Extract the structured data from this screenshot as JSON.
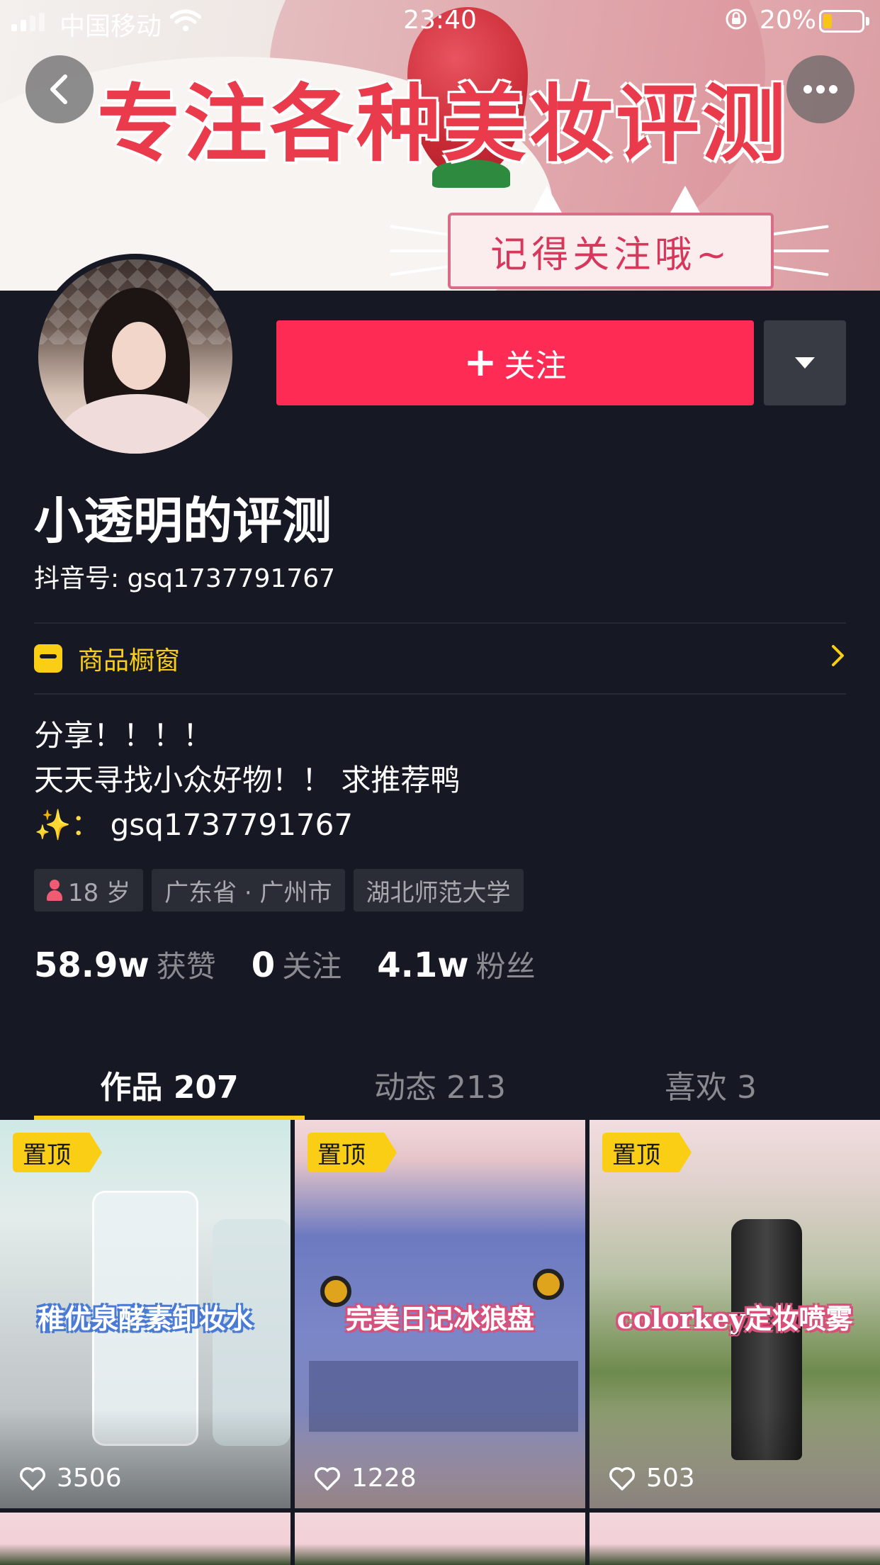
{
  "status_bar": {
    "carrier": "中国移动",
    "time": "23:40",
    "battery": "20%"
  },
  "banner": {
    "title": "专注各种美妆评测",
    "subtitle": "记得关注哦~"
  },
  "header": {
    "back_icon": "back-chevron-icon",
    "more_icon": "more-dots-icon"
  },
  "profile": {
    "follow_label": "关注",
    "follow_plus": "+",
    "name": "小透明的评测",
    "douyin_id": "抖音号: gsq1737791767"
  },
  "shop": {
    "label": "商品橱窗",
    "icon": "shop-icon"
  },
  "bio": {
    "line1": "分享！！！！",
    "line2": "天天寻找小众好物！！ 求推荐鸭",
    "line3_prefix": "✨：",
    "line3_value": "gsq1737791767"
  },
  "tags": {
    "age": "18 岁",
    "location": "广东省 · 广州市",
    "school": "湖北师范大学"
  },
  "stats": {
    "likes_num": "58.9w",
    "likes_label": "获赞",
    "following_num": "0",
    "following_label": "关注",
    "fans_num": "4.1w",
    "fans_label": "粉丝"
  },
  "tabs": [
    {
      "label": "作品 207"
    },
    {
      "label": "动态 213"
    },
    {
      "label": "喜欢 3"
    }
  ],
  "videos": [
    {
      "pin": "置顶",
      "cover_text": "稚优泉酵素卸妆水",
      "likes": "3506"
    },
    {
      "pin": "置顶",
      "cover_text": "完美日记冰狼盘",
      "likes": "1228"
    },
    {
      "pin": "置顶",
      "cover_text": "colorkey定妆喷雾",
      "likes": "503"
    }
  ],
  "colors": {
    "background": "#161823",
    "follow_red": "#fe2c55",
    "accent_yellow": "#face15"
  }
}
